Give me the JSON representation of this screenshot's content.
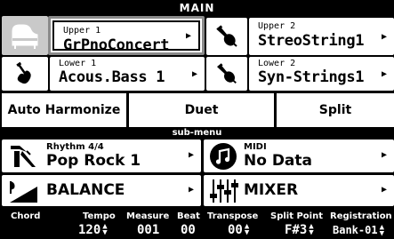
{
  "screen": {
    "title": "MAIN",
    "submenu_title": "sub-menu"
  },
  "parts": [
    {
      "slot": "Upper 1",
      "tone": "GrPnoConcert",
      "icon": "grand-piano-icon",
      "selected": true
    },
    {
      "slot": "Upper 2",
      "tone": "StreoString1",
      "icon": "violin-icon",
      "selected": false
    },
    {
      "slot": "Lower 1",
      "tone": "Acous.Bass 1",
      "icon": "bass-guitar-icon",
      "selected": false
    },
    {
      "slot": "Lower 2",
      "tone": "Syn-Strings1",
      "icon": "violin-icon",
      "selected": false
    }
  ],
  "modes": [
    "Auto Harmonize",
    "Duet",
    "Split"
  ],
  "submenu": {
    "rhythm": {
      "label": "Rhythm 4/4",
      "value": "Pop Rock 1",
      "icon": "metronome-icon"
    },
    "midi": {
      "label": "MIDI",
      "value": "No Data",
      "icon": "music-note-icon"
    },
    "balance": {
      "label": "BALANCE",
      "icon": "balance-icon"
    },
    "mixer": {
      "label": "MIXER",
      "icon": "mixer-faders-icon"
    }
  },
  "status": {
    "chord": {
      "label": "Chord",
      "value": ""
    },
    "tempo": {
      "label": "Tempo",
      "value": "120"
    },
    "measure": {
      "label": "Measure",
      "value": "001"
    },
    "beat": {
      "label": "Beat",
      "value": "00"
    },
    "transpose": {
      "label": "Transpose",
      "value": "00"
    },
    "split_point": {
      "label": "Split Point",
      "value": "F#3"
    },
    "registration": {
      "label": "Registration",
      "value": "Bank-01"
    }
  },
  "colors": {
    "background": "#000000",
    "panel": "#ffffff",
    "selected_frame": "#8a8a8a",
    "selected_icon": "#c9c9c9"
  }
}
